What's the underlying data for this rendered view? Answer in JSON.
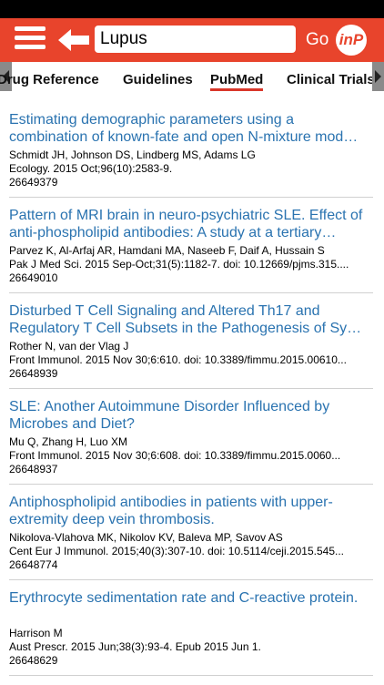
{
  "header": {
    "search_value": "Lupus",
    "go_label": "Go",
    "logo_text": "inP"
  },
  "tabs": [
    {
      "label": "Drug Reference"
    },
    {
      "label": "Guidelines"
    },
    {
      "label": "PubMed"
    },
    {
      "label": "Clinical Trials"
    }
  ],
  "articles": [
    {
      "title": "Estimating demographic parameters using a combination of known-fate and open N-mixture mod…",
      "authors": "Schmidt JH, Johnson DS, Lindberg MS, Adams LG",
      "journal": "Ecology. 2015 Oct;96(10):2583-9.",
      "pmid": "26649379"
    },
    {
      "title": "Pattern of MRI brain in neuro-psychiatric SLE. Effect of anti-phospholipid antibodies: A study at a tertiary…",
      "authors": "Parvez K, Al-Arfaj AR, Hamdani MA, Naseeb F, Daif A, Hussain S",
      "journal": "Pak J Med Sci. 2015 Sep-Oct;31(5):1182-7. doi: 10.12669/pjms.315....",
      "pmid": "26649010"
    },
    {
      "title": "Disturbed T Cell Signaling and Altered Th17 and Regulatory T Cell Subsets in the  Pathogenesis of Sy…",
      "authors": "Rother N, van der Vlag J",
      "journal": "Front Immunol. 2015 Nov 30;6:610. doi: 10.3389/fimmu.2015.00610...",
      "pmid": "26648939"
    },
    {
      "title": "SLE: Another Autoimmune Disorder Influenced by Microbes and Diet?",
      "authors": "Mu Q, Zhang H, Luo XM",
      "journal": "Front Immunol. 2015 Nov 30;6:608. doi: 10.3389/fimmu.2015.0060...",
      "pmid": "26648937"
    },
    {
      "title": "Antiphospholipid antibodies in patients with upper-extremity deep vein thrombosis.",
      "authors": "Nikolova-Vlahova MK, Nikolov KV, Baleva MP, Savov AS",
      "journal": "Cent Eur J Immunol. 2015;40(3):307-10. doi: 10.5114/ceji.2015.545...",
      "pmid": "26648774"
    },
    {
      "title": "Erythrocyte sedimentation rate and C-reactive protein.",
      "authors": "Harrison M",
      "journal": "Aust Prescr. 2015 Jun;38(3):93-4. Epub 2015 Jun 1.",
      "pmid": "26648629"
    }
  ],
  "colors": {
    "brand": "#e8442c",
    "link": "#2a73b0",
    "tab_underline": "#d9372a"
  }
}
